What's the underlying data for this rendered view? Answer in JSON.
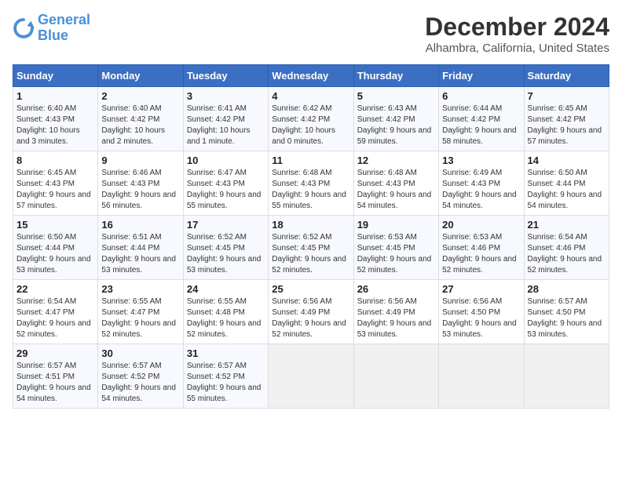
{
  "header": {
    "logo_line1": "General",
    "logo_line2": "Blue",
    "month": "December 2024",
    "location": "Alhambra, California, United States"
  },
  "weekdays": [
    "Sunday",
    "Monday",
    "Tuesday",
    "Wednesday",
    "Thursday",
    "Friday",
    "Saturday"
  ],
  "weeks": [
    [
      {
        "day": "1",
        "sunrise": "6:40 AM",
        "sunset": "4:43 PM",
        "daylight": "10 hours and 3 minutes."
      },
      {
        "day": "2",
        "sunrise": "6:40 AM",
        "sunset": "4:42 PM",
        "daylight": "10 hours and 2 minutes."
      },
      {
        "day": "3",
        "sunrise": "6:41 AM",
        "sunset": "4:42 PM",
        "daylight": "10 hours and 1 minute."
      },
      {
        "day": "4",
        "sunrise": "6:42 AM",
        "sunset": "4:42 PM",
        "daylight": "10 hours and 0 minutes."
      },
      {
        "day": "5",
        "sunrise": "6:43 AM",
        "sunset": "4:42 PM",
        "daylight": "9 hours and 59 minutes."
      },
      {
        "day": "6",
        "sunrise": "6:44 AM",
        "sunset": "4:42 PM",
        "daylight": "9 hours and 58 minutes."
      },
      {
        "day": "7",
        "sunrise": "6:45 AM",
        "sunset": "4:42 PM",
        "daylight": "9 hours and 57 minutes."
      }
    ],
    [
      {
        "day": "8",
        "sunrise": "6:45 AM",
        "sunset": "4:43 PM",
        "daylight": "9 hours and 57 minutes."
      },
      {
        "day": "9",
        "sunrise": "6:46 AM",
        "sunset": "4:43 PM",
        "daylight": "9 hours and 56 minutes."
      },
      {
        "day": "10",
        "sunrise": "6:47 AM",
        "sunset": "4:43 PM",
        "daylight": "9 hours and 55 minutes."
      },
      {
        "day": "11",
        "sunrise": "6:48 AM",
        "sunset": "4:43 PM",
        "daylight": "9 hours and 55 minutes."
      },
      {
        "day": "12",
        "sunrise": "6:48 AM",
        "sunset": "4:43 PM",
        "daylight": "9 hours and 54 minutes."
      },
      {
        "day": "13",
        "sunrise": "6:49 AM",
        "sunset": "4:43 PM",
        "daylight": "9 hours and 54 minutes."
      },
      {
        "day": "14",
        "sunrise": "6:50 AM",
        "sunset": "4:44 PM",
        "daylight": "9 hours and 54 minutes."
      }
    ],
    [
      {
        "day": "15",
        "sunrise": "6:50 AM",
        "sunset": "4:44 PM",
        "daylight": "9 hours and 53 minutes."
      },
      {
        "day": "16",
        "sunrise": "6:51 AM",
        "sunset": "4:44 PM",
        "daylight": "9 hours and 53 minutes."
      },
      {
        "day": "17",
        "sunrise": "6:52 AM",
        "sunset": "4:45 PM",
        "daylight": "9 hours and 53 minutes."
      },
      {
        "day": "18",
        "sunrise": "6:52 AM",
        "sunset": "4:45 PM",
        "daylight": "9 hours and 52 minutes."
      },
      {
        "day": "19",
        "sunrise": "6:53 AM",
        "sunset": "4:45 PM",
        "daylight": "9 hours and 52 minutes."
      },
      {
        "day": "20",
        "sunrise": "6:53 AM",
        "sunset": "4:46 PM",
        "daylight": "9 hours and 52 minutes."
      },
      {
        "day": "21",
        "sunrise": "6:54 AM",
        "sunset": "4:46 PM",
        "daylight": "9 hours and 52 minutes."
      }
    ],
    [
      {
        "day": "22",
        "sunrise": "6:54 AM",
        "sunset": "4:47 PM",
        "daylight": "9 hours and 52 minutes."
      },
      {
        "day": "23",
        "sunrise": "6:55 AM",
        "sunset": "4:47 PM",
        "daylight": "9 hours and 52 minutes."
      },
      {
        "day": "24",
        "sunrise": "6:55 AM",
        "sunset": "4:48 PM",
        "daylight": "9 hours and 52 minutes."
      },
      {
        "day": "25",
        "sunrise": "6:56 AM",
        "sunset": "4:49 PM",
        "daylight": "9 hours and 52 minutes."
      },
      {
        "day": "26",
        "sunrise": "6:56 AM",
        "sunset": "4:49 PM",
        "daylight": "9 hours and 53 minutes."
      },
      {
        "day": "27",
        "sunrise": "6:56 AM",
        "sunset": "4:50 PM",
        "daylight": "9 hours and 53 minutes."
      },
      {
        "day": "28",
        "sunrise": "6:57 AM",
        "sunset": "4:50 PM",
        "daylight": "9 hours and 53 minutes."
      }
    ],
    [
      {
        "day": "29",
        "sunrise": "6:57 AM",
        "sunset": "4:51 PM",
        "daylight": "9 hours and 54 minutes."
      },
      {
        "day": "30",
        "sunrise": "6:57 AM",
        "sunset": "4:52 PM",
        "daylight": "9 hours and 54 minutes."
      },
      {
        "day": "31",
        "sunrise": "6:57 AM",
        "sunset": "4:52 PM",
        "daylight": "9 hours and 55 minutes."
      },
      null,
      null,
      null,
      null
    ]
  ]
}
